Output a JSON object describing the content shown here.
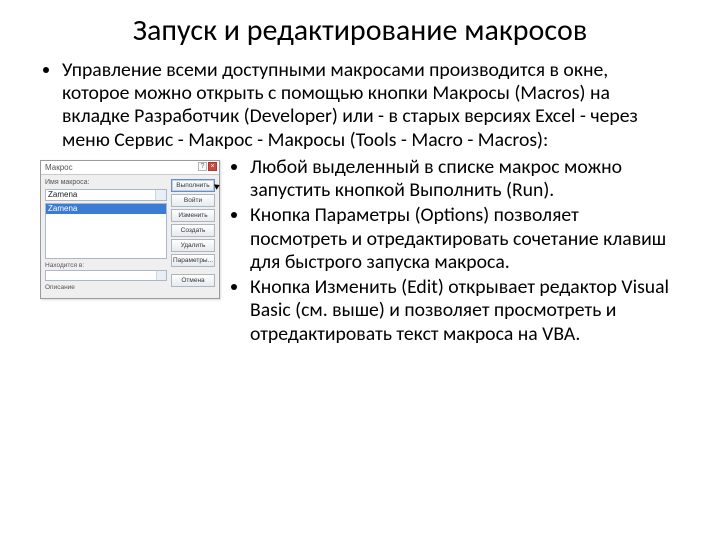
{
  "title": "Запуск и редактирование макросов",
  "intro": "Управление всеми доступными макросами производится в окне, которое можно открыть с помощью кнопки Макросы (Macros) на вкладке Разработчик (Developer) или - в старых версиях Excel - через меню Сервис - Макрос - Макросы (Tools - Macro - Macros):",
  "bullets": [
    "Любой выделенный в списке макрос можно запустить кнопкой Выполнить (Run).",
    "Кнопка Параметры (Options) позволяет посмотреть и отредактировать сочетание клавиш для быстрого запуска макроса.",
    "Кнопка Изменить (Edit) открывает редактор Visual Basic (см. выше) и позволяет просмотреть и отредактировать текст макроса на VBA."
  ],
  "dialog": {
    "title": "Макрос",
    "name_label": "Имя макроса:",
    "name_value": "Zamena",
    "list_item": "Zamena",
    "where_label": "Находится в:",
    "desc_label": "Описание",
    "buttons": {
      "run": "Выполнить",
      "step": "Войти",
      "edit": "Изменить",
      "create": "Создать",
      "delete": "Удалить",
      "options": "Параметры...",
      "cancel": "Отмена"
    }
  }
}
